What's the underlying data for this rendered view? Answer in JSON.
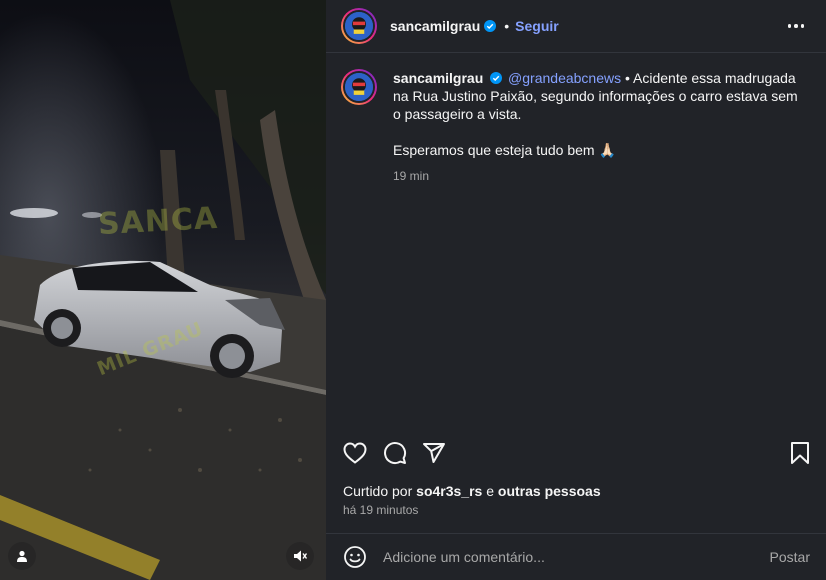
{
  "post": {
    "username": "sancamilgrau",
    "follow_label": "Seguir",
    "separator": "•",
    "verified_icon": "verified-badge-icon",
    "more_icon": "more-options-icon"
  },
  "caption": {
    "username": "sancamilgrau",
    "mention": "@grandeabcnews",
    "text_part1": " • Acidente essa madrugada na Rua Justino Paixão, segundo informações o carro estava sem o passageiro a vista.",
    "text_part2": "Esperamos que esteja tudo bem 🙏🏻",
    "time": "19 min"
  },
  "media": {
    "watermark_top": "SANCA",
    "watermark_bottom": "MIL GRAU",
    "user_icon": "person-icon",
    "mute_icon": "speaker-muted-icon"
  },
  "actions": {
    "like_icon": "heart-icon",
    "comment_icon": "comment-icon",
    "share_icon": "send-icon",
    "save_icon": "bookmark-icon"
  },
  "likes": {
    "prefix": "Curtido por ",
    "user": "so4r3s_rs",
    "connector": " e ",
    "others": "outras pessoas"
  },
  "posted_ago": "há 19 minutos",
  "comment_box": {
    "emoji_icon": "emoji-icon",
    "placeholder": "Adicione um comentário...",
    "post_label": "Postar"
  },
  "colors": {
    "panel_bg": "#212328",
    "link_blue": "#85a1ff",
    "muted_text": "#a8a8a8",
    "verified_blue": "#0095f6"
  }
}
